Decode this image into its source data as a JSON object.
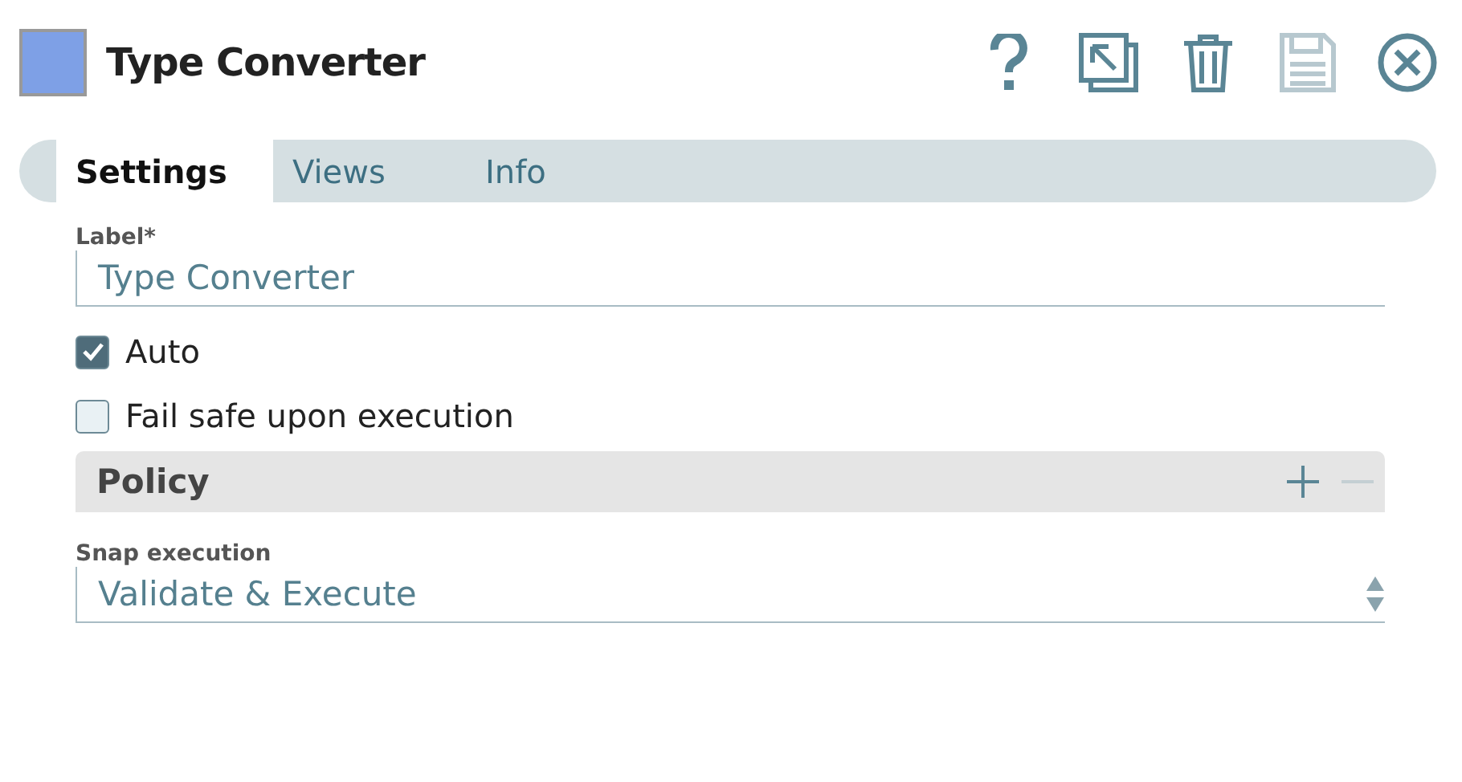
{
  "window": {
    "title": "Type Converter",
    "color": "#7ea0e6"
  },
  "toolbar": [
    {
      "kind": "help",
      "disabled": false
    },
    {
      "kind": "expand",
      "disabled": false
    },
    {
      "kind": "delete",
      "disabled": false
    },
    {
      "kind": "save",
      "disabled": true
    },
    {
      "kind": "close",
      "disabled": false
    }
  ],
  "tabs": [
    {
      "label": "Settings",
      "selected": true
    },
    {
      "label": "Views",
      "selected": false
    },
    {
      "label": "Info",
      "selected": false
    }
  ],
  "label_field": {
    "label": "Label*",
    "value": "Type Converter"
  },
  "checkboxes": [
    {
      "label": "Auto",
      "checked": true
    },
    {
      "label": "Fail safe upon execution",
      "checked": false
    }
  ],
  "policy": {
    "title": "Policy",
    "add_disabled": false,
    "remove_disabled": true
  },
  "snap_execution": {
    "label": "Snap execution",
    "value": "Validate & Execute"
  }
}
